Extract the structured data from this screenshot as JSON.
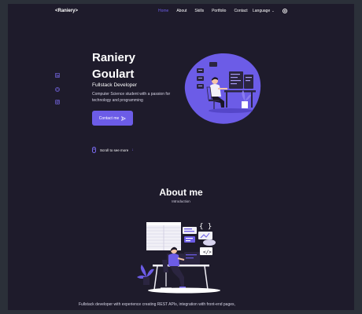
{
  "header": {
    "logo": "<Raniery>",
    "nav": [
      "Home",
      "About",
      "Skills",
      "Portfolio",
      "Contact"
    ],
    "language_label": "Language",
    "active": "Home"
  },
  "hero": {
    "first_name": "Raniery",
    "last_name": "Goulart",
    "role": "Fullstack Developer",
    "description": "Computer Science student with a passion for technology and programming",
    "contact_button": "Contact me",
    "scroll_label": "Scroll to see more"
  },
  "social_icons": [
    "linkedin-icon",
    "github-icon",
    "instagram-icon"
  ],
  "about": {
    "title": "About me",
    "subtitle": "Introduction",
    "text": "Fullstack developer with experience creating REST APIs, integration with front-end pages,"
  },
  "colors": {
    "accent": "#6c5ce7",
    "background": "#1e1b2b",
    "frame": "#2b3039"
  }
}
